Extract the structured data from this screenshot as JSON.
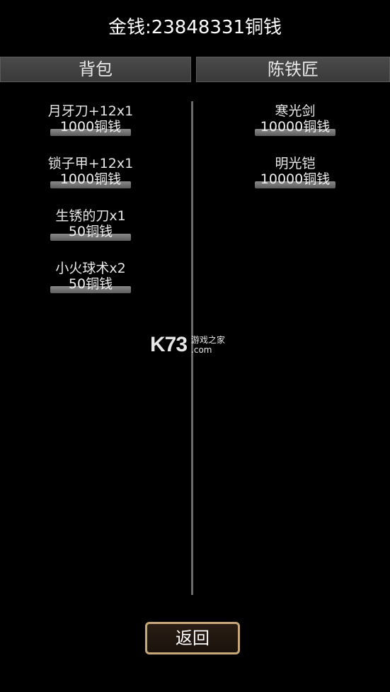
{
  "money_label": "金钱:23848331铜钱",
  "backpack": {
    "title": "背包",
    "items": [
      {
        "name": "月牙刀+12x1",
        "price": "1000铜钱"
      },
      {
        "name": "锁子甲+12x1",
        "price": "1000铜钱"
      },
      {
        "name": "生锈的刀x1",
        "price": "50铜钱"
      },
      {
        "name": "小火球术x2",
        "price": "50铜钱"
      }
    ]
  },
  "blacksmith": {
    "title": "陈铁匠",
    "items": [
      {
        "name": "寒光剑",
        "price": "10000铜钱"
      },
      {
        "name": "明光铠",
        "price": "10000铜钱"
      }
    ]
  },
  "watermark": {
    "logo": "K73",
    "sub1": "游戏之家",
    "sub2": ".com"
  },
  "back_label": "返回"
}
